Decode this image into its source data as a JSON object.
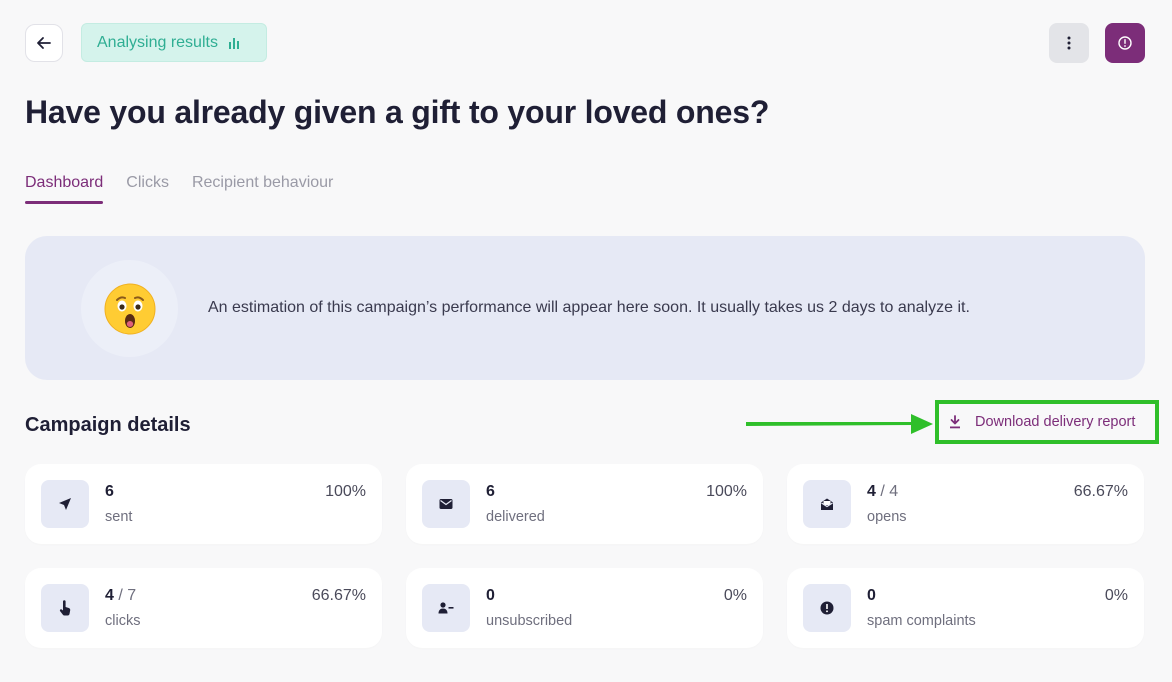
{
  "header": {
    "status_label": "Analysing results"
  },
  "title": "Have you already given a gift to your loved ones?",
  "tabs": [
    {
      "label": "Dashboard",
      "active": true
    },
    {
      "label": "Clicks",
      "active": false
    },
    {
      "label": "Recipient behaviour",
      "active": false
    }
  ],
  "estimate": {
    "emoji": "😲",
    "text": "An estimation of this campaign’s performance will appear here soon. It usually takes us 2 days to analyze it."
  },
  "campaign_details": {
    "title": "Campaign details",
    "download_label": "Download delivery report"
  },
  "stats": [
    {
      "value": "6",
      "total": "",
      "label": "sent",
      "percent": "100%",
      "icon": "send-icon"
    },
    {
      "value": "6",
      "total": "",
      "label": "delivered",
      "percent": "100%",
      "icon": "envelope-icon"
    },
    {
      "value": "4",
      "total": "4",
      "label": "opens",
      "percent": "66.67%",
      "icon": "open-envelope-icon"
    },
    {
      "value": "4",
      "total": "7",
      "label": "clicks",
      "percent": "66.67%",
      "icon": "pointer-icon"
    },
    {
      "value": "0",
      "total": "",
      "label": "unsubscribed",
      "percent": "0%",
      "icon": "user-minus-icon"
    },
    {
      "value": "0",
      "total": "",
      "label": "spam complaints",
      "percent": "0%",
      "icon": "alert-icon"
    }
  ],
  "colors": {
    "accent": "#7c2d79",
    "status_bg": "#d5f3ec",
    "status_text": "#2fae93",
    "highlight": "#2fbf2a"
  }
}
